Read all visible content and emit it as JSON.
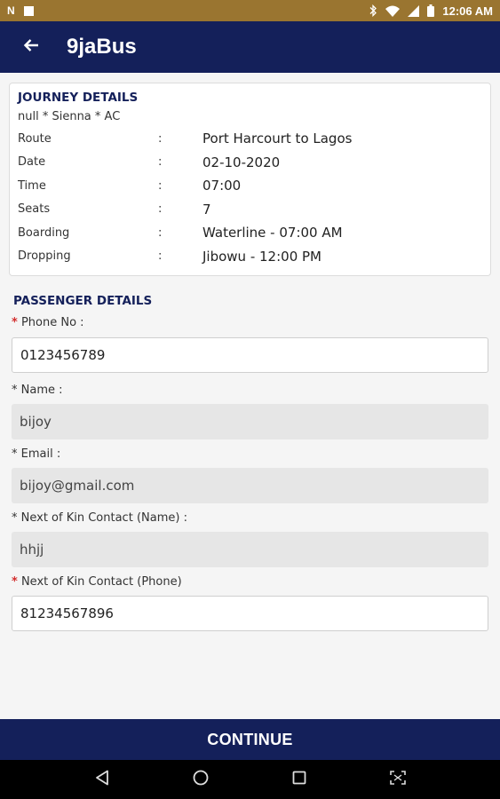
{
  "status_bar": {
    "time": "12:06 AM",
    "icons": [
      "n-icon",
      "square-icon",
      "bluetooth-icon",
      "wifi-icon",
      "signal-icon",
      "battery-icon"
    ]
  },
  "app_bar": {
    "title": "9jaBus",
    "back_icon": "arrow-back-icon"
  },
  "journey": {
    "title": "JOURNEY DETAILS",
    "subtitle": "null * Sienna * AC",
    "rows": [
      {
        "label": "Route",
        "colon": ":",
        "value": "Port Harcourt to Lagos"
      },
      {
        "label": "Date",
        "colon": ":",
        "value": "02-10-2020"
      },
      {
        "label": "Time",
        "colon": ":",
        "value": "07:00"
      },
      {
        "label": "Seats",
        "colon": ":",
        "value": "7"
      },
      {
        "label": "Boarding",
        "colon": ":",
        "value": "Waterline - 07:00 AM"
      },
      {
        "label": "Dropping",
        "colon": ":",
        "value": "Jibowu - 12:00 PM"
      }
    ]
  },
  "passenger": {
    "title": "PASSENGER DETAILS",
    "fields": [
      {
        "label": "Phone No :",
        "value": "0123456789",
        "required_mark": "*",
        "required_color": "#d32f2f"
      },
      {
        "label": "Name :",
        "value": "bijoy",
        "required_mark": "*"
      },
      {
        "label": "Email :",
        "value": "bijoy@gmail.com",
        "required_mark": "*"
      },
      {
        "label": "Next of Kin Contact (Name) :",
        "value": "hhjj",
        "required_mark": "*"
      },
      {
        "label": "Next of Kin Contact (Phone)",
        "value": "81234567896",
        "required_mark": "*",
        "required_color": "#d32f2f"
      }
    ]
  },
  "continue_label": "CONTINUE",
  "colors": {
    "status_bar": "#9a7530",
    "primary": "#14205a",
    "background": "#f5f5f5",
    "required": "#d32f2f"
  },
  "nav": {
    "icons": [
      "back-triangle-icon",
      "home-circle-icon",
      "recents-square-icon",
      "screenshot-icon"
    ]
  }
}
